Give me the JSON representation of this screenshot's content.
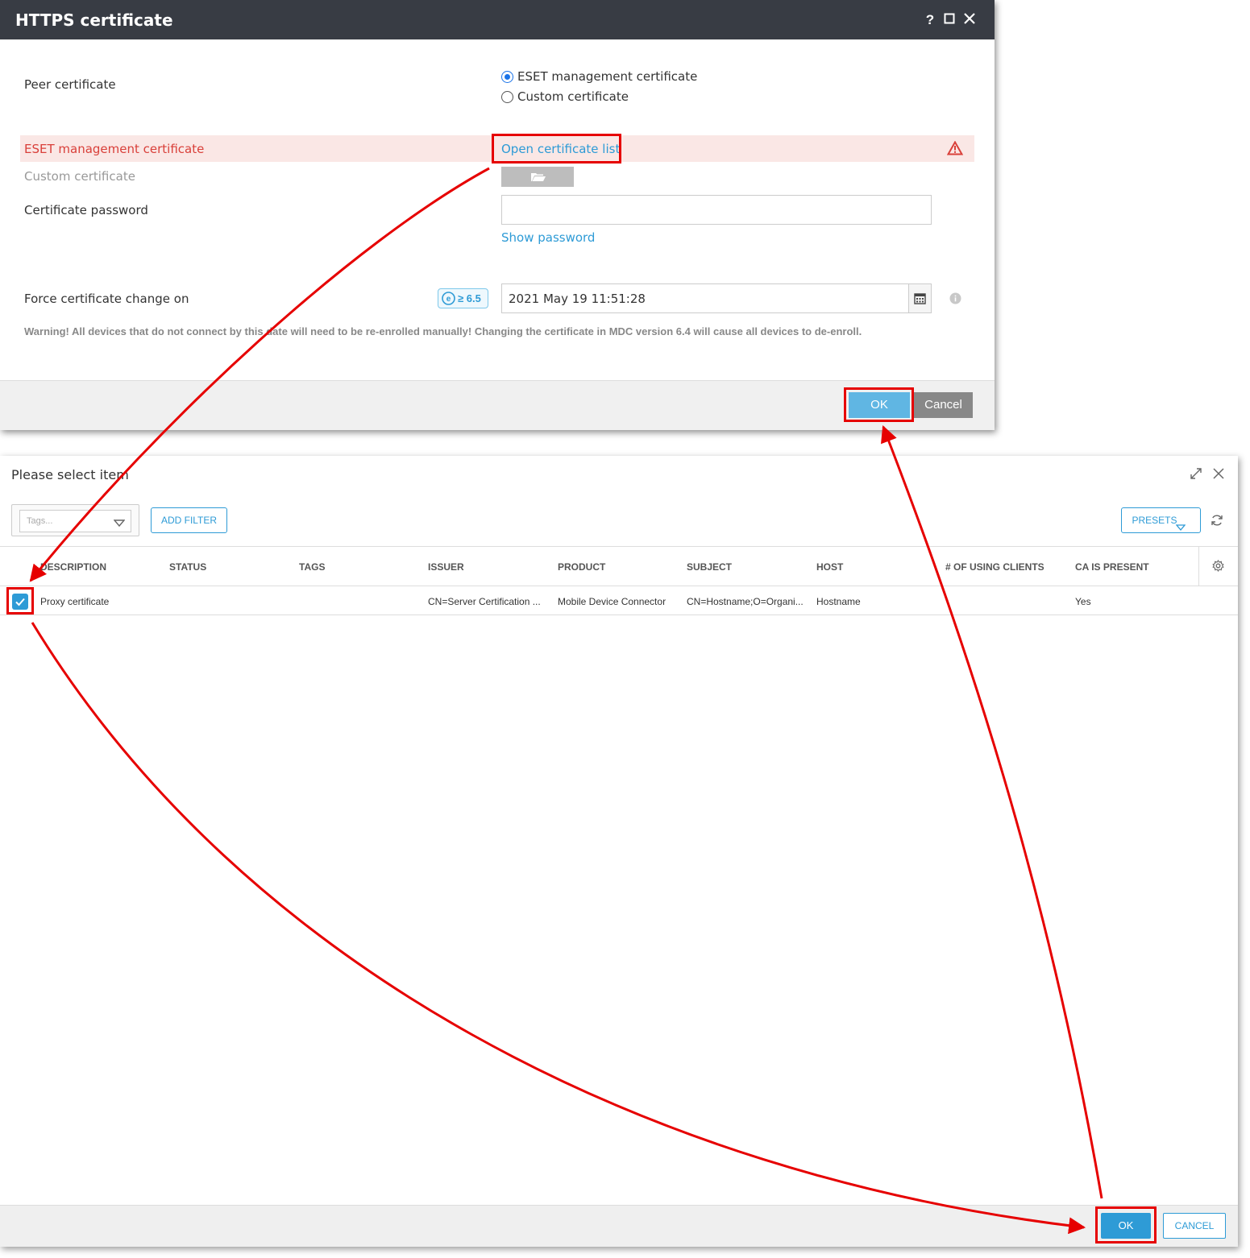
{
  "https_dialog": {
    "title": "HTTPS certificate",
    "help_label": "?",
    "peer_certificate": {
      "label": "Peer certificate",
      "options": [
        {
          "label": "ESET management certificate",
          "selected": true
        },
        {
          "label": "Custom certificate",
          "selected": false
        }
      ]
    },
    "eset_cert_label": "ESET management certificate",
    "open_cert_list": "Open certificate list",
    "custom_cert_label": "Custom certificate",
    "cert_password_label": "Certificate password",
    "show_password": "Show password",
    "force_change_label": "Force certificate change on",
    "version_badge": "≥ 6.5",
    "force_change_date": "2021 May 19 11:51:28",
    "warning": "Warning! All devices that do not connect by this date will need to be re-enrolled manually! Changing the certificate in MDC version 6.4 will cause all devices to de-enroll.",
    "ok_label": "OK",
    "cancel_label": "Cancel"
  },
  "select_dialog": {
    "title": "Please select item",
    "tags_placeholder": "Tags...",
    "add_filter": "ADD FILTER",
    "presets": "PRESETS",
    "columns": [
      "DESCRIPTION",
      "STATUS",
      "TAGS",
      "ISSUER",
      "PRODUCT",
      "SUBJECT",
      "HOST",
      "# OF USING CLIENTS",
      "CA IS PRESENT"
    ],
    "rows": [
      {
        "checked": true,
        "description": "Proxy certificate",
        "status": "",
        "tags": "",
        "issuer": "CN=Server Certification ...",
        "product": "Mobile Device Connector",
        "subject": "CN=Hostname;O=Organi...",
        "host": "Hostname",
        "using_clients": "",
        "ca_present": "Yes"
      }
    ],
    "ok_label": "OK",
    "cancel_label": "CANCEL"
  },
  "colors": {
    "titlebar": "#383c44",
    "accent": "#2e9bd6",
    "error_bg": "#fae7e5",
    "error_text": "#d9403a",
    "annotation_red": "#e60000"
  }
}
